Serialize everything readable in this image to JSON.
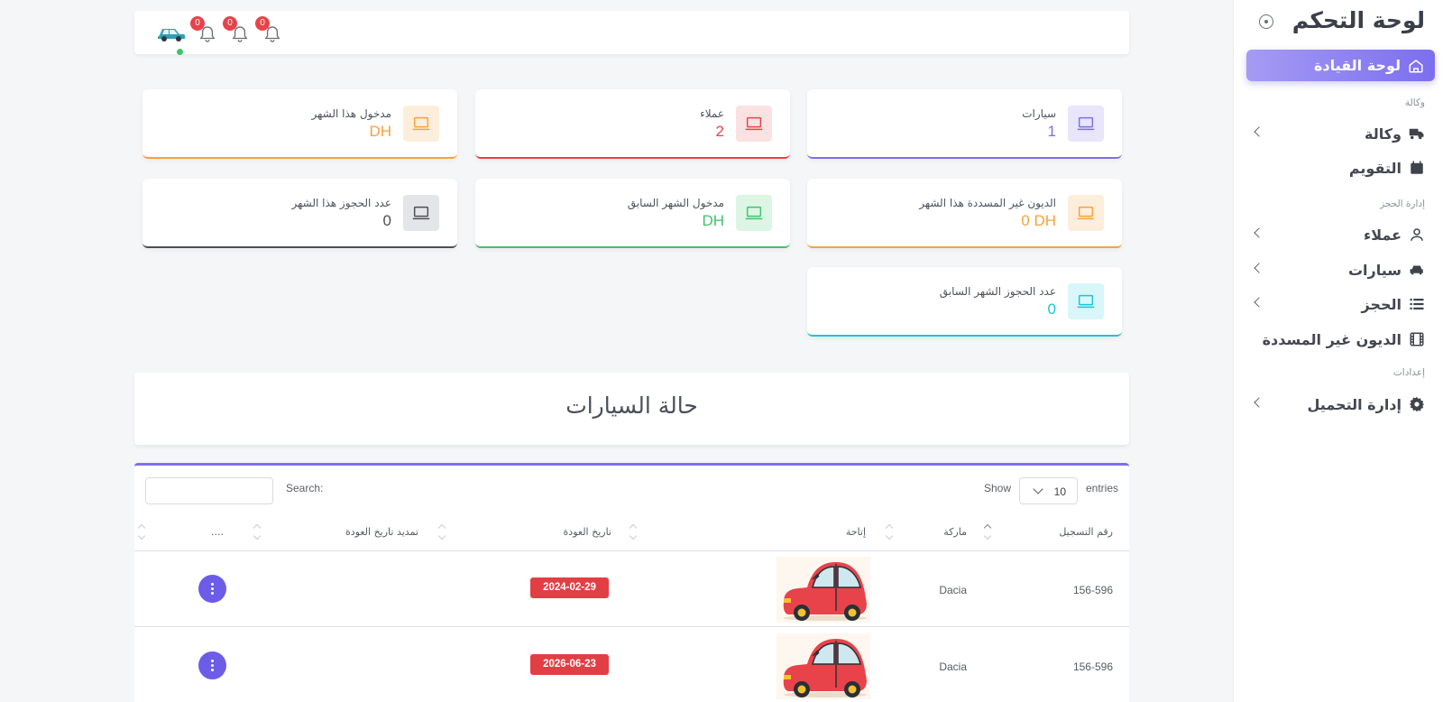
{
  "sidebar": {
    "title": "لوحة التحكم",
    "active_item": "لوحة القيادة",
    "sections": [
      {
        "label": "وكالة",
        "items": [
          {
            "label": "وكالة",
            "icon": "truck-icon",
            "chevron": true
          },
          {
            "label": "التقويم",
            "icon": "calendar-icon",
            "chevron": false
          }
        ]
      },
      {
        "label": "إدارة الحجز",
        "items": [
          {
            "label": "عملاء",
            "icon": "user-icon",
            "chevron": true
          },
          {
            "label": "سيارات",
            "icon": "car-icon",
            "chevron": true
          },
          {
            "label": "الحجز",
            "icon": "list-icon",
            "chevron": true
          },
          {
            "label": "الديون غير المسددة",
            "icon": "film-icon",
            "chevron": false
          }
        ]
      },
      {
        "label": "إعدادات",
        "items": [
          {
            "label": "إدارة التحميل",
            "icon": "gear-icon",
            "chevron": true
          }
        ]
      }
    ]
  },
  "topbar": {
    "notifications": [
      "0",
      "0",
      "0"
    ]
  },
  "stats": [
    {
      "label": "سيارات",
      "value": "1",
      "color": "#7c6ef0",
      "bg": "#e8e5fc"
    },
    {
      "label": "عملاء",
      "value": "2",
      "color": "#e8434a",
      "bg": "#fbe1e2"
    },
    {
      "label": "مدخول هذا الشهر",
      "value": "DH",
      "color": "#f7a23b",
      "bg": "#fdeedb"
    },
    {
      "label": "الديون غير المسددة هذا الشهر",
      "value": "0 DH",
      "color": "#f7a23b",
      "bg": "#fdeedb"
    },
    {
      "label": "مدخول الشهر السابق",
      "value": "DH",
      "color": "#3ec46d",
      "bg": "#dcf5e4"
    },
    {
      "label": "عدد الحجوز هذا الشهر",
      "value": "0",
      "color": "#4a4f59",
      "bg": "#e4e5e8"
    },
    {
      "label": "عدد الحجوز الشهر السابق",
      "value": "0",
      "color": "#19c6d9",
      "bg": "#d9f6fa"
    }
  ],
  "status_title": "حالة السيارات",
  "table": {
    "show_label": "Show",
    "entries_value": "10",
    "entries_label": "entries",
    "search_label": "Search:",
    "columns": [
      "رقم التسجيل",
      "ماركة",
      "إتاحة",
      "تاريخ العودة",
      "تمديد تاريخ العودة",
      "...."
    ],
    "rows": [
      {
        "registration": "156-596",
        "brand": "Dacia",
        "return_date": "2024-02-29"
      },
      {
        "registration": "156-596",
        "brand": "Dacia",
        "return_date": "2026-06-23"
      }
    ]
  }
}
